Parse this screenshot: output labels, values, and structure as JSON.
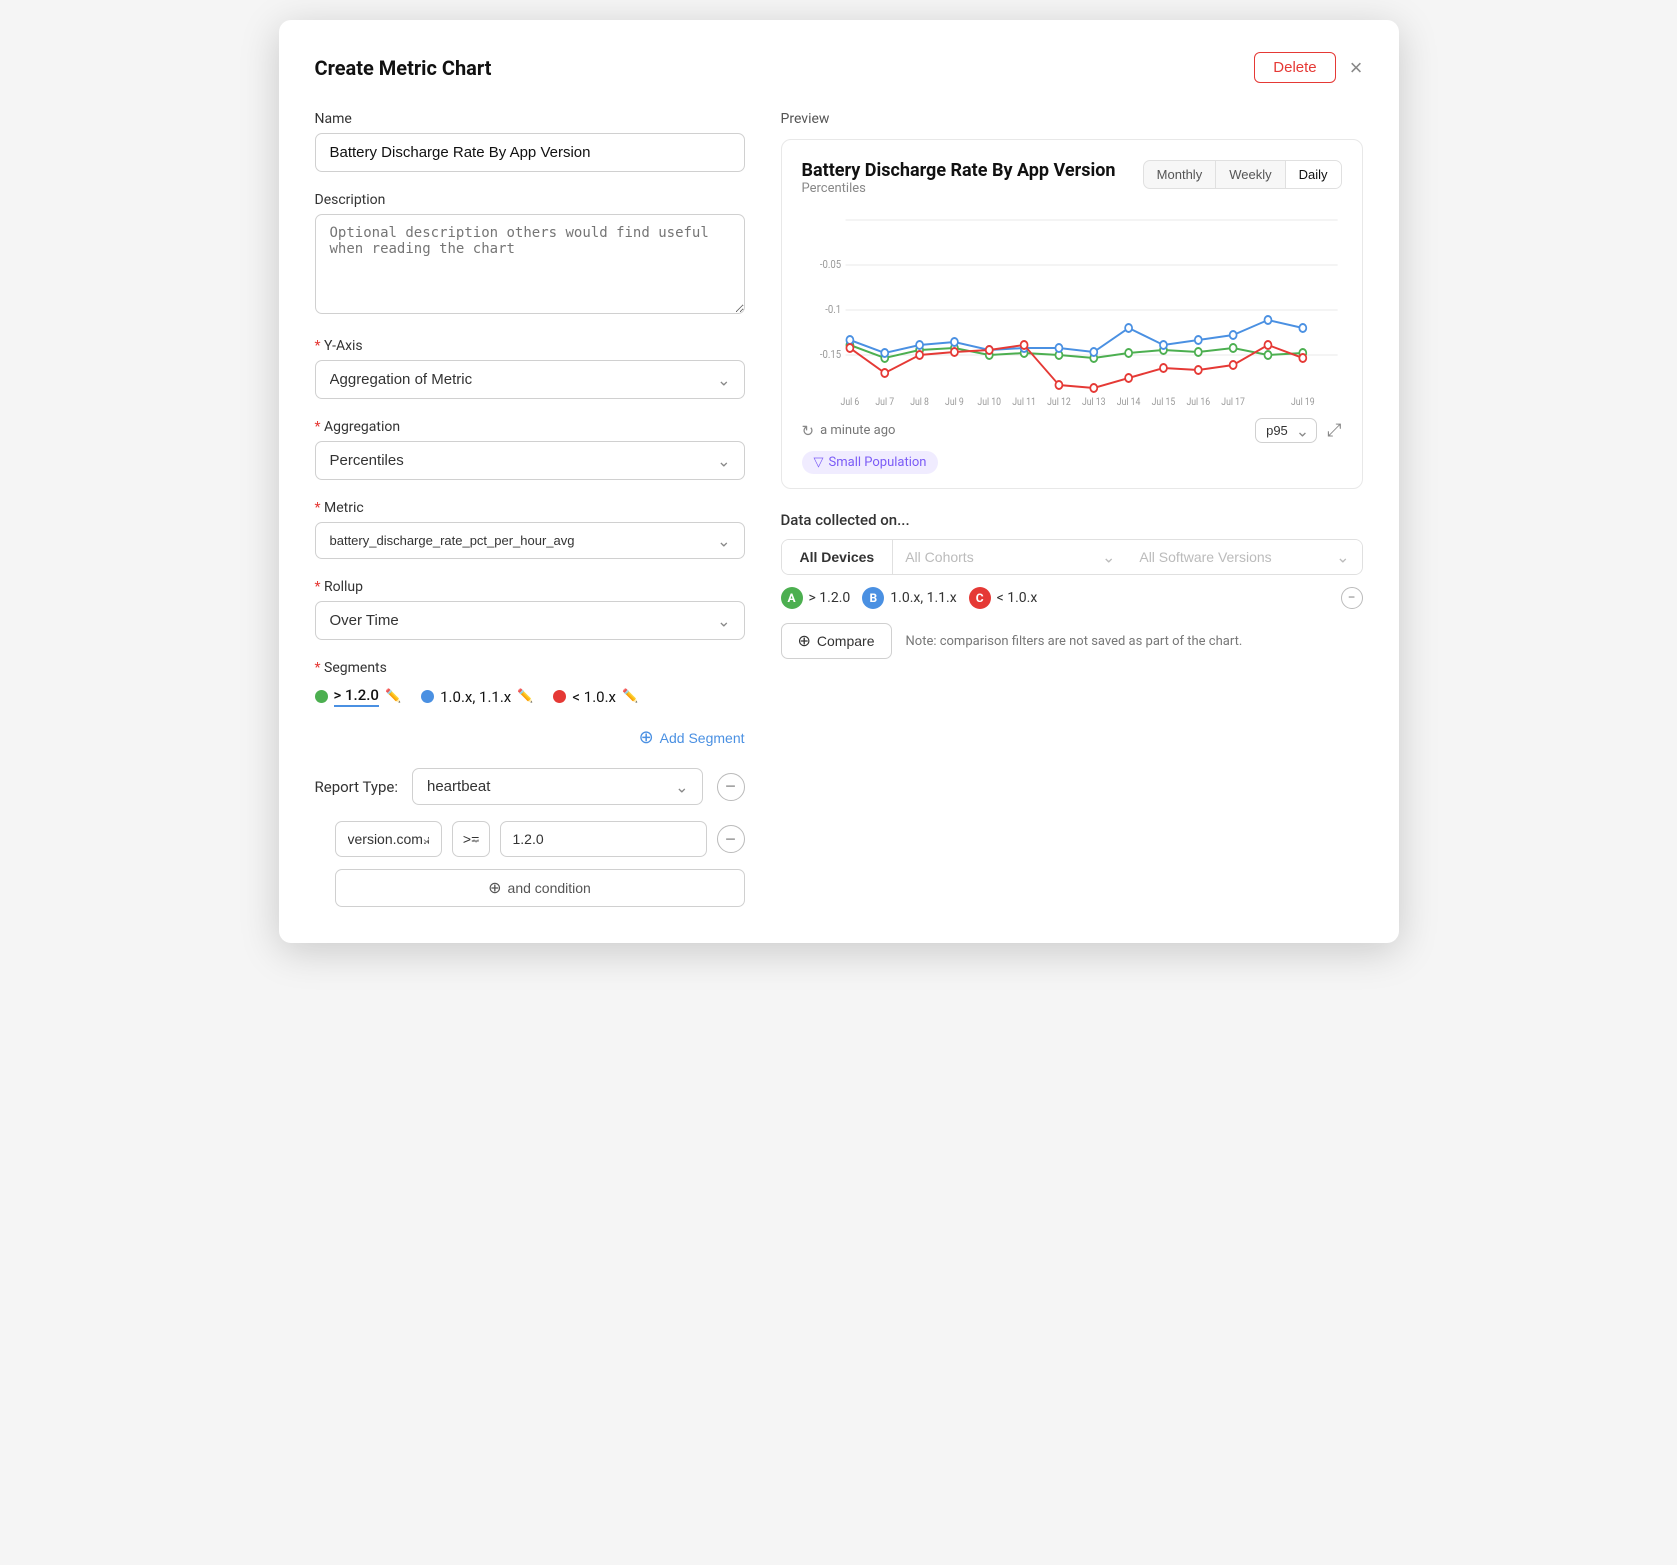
{
  "modal": {
    "title": "Create Metric Chart",
    "delete_label": "Delete",
    "close_icon": "×"
  },
  "form": {
    "name_label": "Name",
    "name_value": "Battery Discharge Rate By App Version",
    "description_label": "Description",
    "description_placeholder": "Optional description others would find useful when reading the chart",
    "yaxis_label": "Y-Axis",
    "yaxis_value": "Aggregation of Metric",
    "aggregation_label": "Aggregation",
    "aggregation_value": "Percentiles",
    "metric_label": "Metric",
    "metric_value": "battery_discharge_rate_pct_per_hour_avg",
    "rollup_label": "Rollup",
    "rollup_value": "Over Time",
    "segments_label": "Segments",
    "segments": [
      {
        "id": "A",
        "color": "#4caf50",
        "label": "> 1.2.0",
        "active": true
      },
      {
        "id": "B",
        "color": "#4a90e2",
        "label": "1.0.x, 1.1.x",
        "active": false
      },
      {
        "id": "C",
        "color": "#e53935",
        "label": "< 1.0.x",
        "active": false
      }
    ],
    "add_segment_label": "Add Segment",
    "report_type_label": "Report Type:",
    "report_type_value": "heartbeat",
    "condition_field": "version.com.app",
    "condition_op": ">=",
    "condition_value": "1.2.0",
    "and_condition_label": "and condition"
  },
  "preview": {
    "label": "Preview",
    "chart_title": "Battery Discharge Rate By App Version",
    "chart_subtitle": "Percentiles",
    "time_tabs": [
      "Monthly",
      "Weekly",
      "Daily"
    ],
    "active_tab": "Daily",
    "refresh_label": "a minute ago",
    "percentile_value": "p95",
    "expand_icon": "⤢",
    "small_pop_label": "Small Population",
    "y_labels": [
      "",
      "-0.05",
      "-0.1",
      "-0.15"
    ],
    "x_labels": [
      "Jul 6",
      "Jul 7",
      "Jul 8",
      "Jul 9",
      "Jul 10",
      "Jul 11",
      "Jul 12",
      "Jul 13",
      "Jul 14",
      "Jul 15",
      "Jul 16",
      "Jul 17",
      "",
      "Jul 19"
    ]
  },
  "data_collected": {
    "label": "Data collected on...",
    "all_devices_label": "All Devices",
    "all_cohorts_label": "All Cohorts",
    "all_software_label": "All Software Versions",
    "version_tags": [
      {
        "id": "A",
        "color": "#4caf50",
        "label": "> 1.2.0"
      },
      {
        "id": "B",
        "color": "#4a90e2",
        "label": "1.0.x, 1.1.x"
      },
      {
        "id": "C",
        "color": "#e53935",
        "label": "< 1.0.x"
      }
    ],
    "compare_label": "Compare",
    "compare_note": "Note: comparison filters are not saved as part of the chart."
  }
}
